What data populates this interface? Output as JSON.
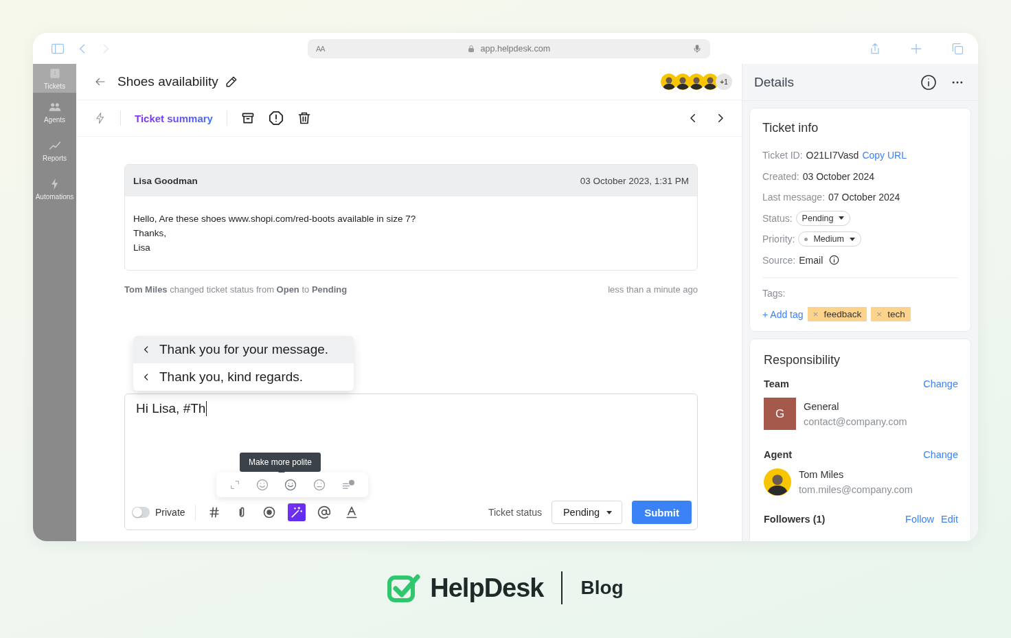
{
  "browser": {
    "text_size": "AA",
    "url": "app.helpdesk.com"
  },
  "sidebar": {
    "items": [
      {
        "label": "Tickets",
        "selected": true
      },
      {
        "label": "Agents",
        "selected": false
      },
      {
        "label": "Reports",
        "selected": false
      },
      {
        "label": "Automations",
        "selected": false
      }
    ]
  },
  "ticket": {
    "title": "Shoes availability",
    "participants_more": "+1",
    "summary_link": "Ticket summary",
    "message": {
      "author": "Lisa Goodman",
      "date": "03 October 2023, 1:31 PM",
      "body": "Hello, Are these shoes www.shopi.com/red-boots available in size 7?\nThanks,\nLisa"
    },
    "activity": {
      "text": "**Tom Miles** changed ticket status from **Open** to **Pending**",
      "time": "less than a minute ago"
    },
    "suggestions": [
      {
        "text": "Thank you for your message.",
        "selected": true
      },
      {
        "text": "Thank you, kind regards.",
        "selected": false
      }
    ],
    "composer": {
      "value": "Hi Lisa, #Th",
      "tooltip": "Make more polite",
      "private": {
        "label": "Private",
        "on": false
      },
      "tools": [
        {
          "kind": "hash",
          "active": false
        },
        {
          "kind": "attach",
          "active": false
        },
        {
          "kind": "record",
          "active": false
        },
        {
          "kind": "magic",
          "active": true
        },
        {
          "kind": "mention",
          "active": false
        },
        {
          "kind": "format",
          "active": false
        }
      ],
      "status_label": "Ticket status",
      "status_value": "Pending",
      "submit": "Submit"
    }
  },
  "details": {
    "title": "Details",
    "ticket_info": {
      "title": "Ticket info",
      "fields": [
        {
          "kind": "link",
          "label": "Ticket ID:",
          "value": "O21LI7Vasd",
          "link": "Copy URL"
        },
        {
          "kind": "text",
          "label": "Created:",
          "value": "03 October 2024"
        },
        {
          "kind": "text",
          "label": "Last message:",
          "value": "07 October 2024"
        },
        {
          "kind": "dropdown",
          "label": "Status:",
          "value": "Pending"
        },
        {
          "kind": "priority",
          "label": "Priority:",
          "value": "Medium"
        },
        {
          "kind": "info",
          "label": "Source:",
          "value": "Email"
        }
      ],
      "tags_label": "Tags:",
      "add_tag": "+ Add tag",
      "tags": [
        {
          "remove": "×",
          "text": "feedback"
        },
        {
          "remove": "×",
          "text": "tech"
        }
      ]
    },
    "responsibility": {
      "title": "Responsibility",
      "team": {
        "label": "Team",
        "action": "Change",
        "initial": "G",
        "name": "General",
        "email": "contact@company.com"
      },
      "agent": {
        "label": "Agent",
        "action": "Change",
        "name": "Tom Miles",
        "email": "tom.miles@company.com"
      },
      "followers": {
        "label": "Followers (1)",
        "actions": [
          "Follow",
          "Edit"
        ]
      }
    }
  },
  "brand": {
    "name": "HelpDesk",
    "section": "Blog"
  }
}
